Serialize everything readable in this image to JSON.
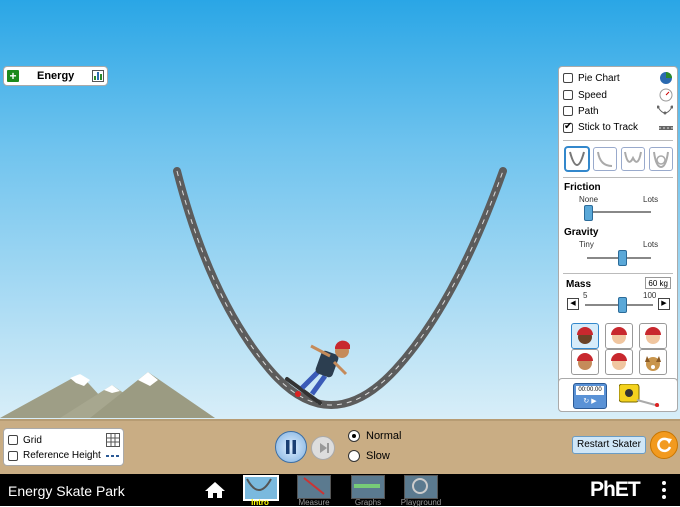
{
  "energy_panel": {
    "label": "Energy"
  },
  "options": [
    {
      "label": "Pie Chart",
      "checked": false,
      "icon": "pie-chart-icon"
    },
    {
      "label": "Speed",
      "checked": false,
      "icon": "speedometer-icon"
    },
    {
      "label": "Path",
      "checked": false,
      "icon": "path-icon"
    },
    {
      "label": "Stick to Track",
      "checked": true,
      "icon": "track-icon"
    }
  ],
  "tracks": [
    {
      "name": "parabola",
      "selected": true
    },
    {
      "name": "ramp",
      "selected": false
    },
    {
      "name": "double-well",
      "selected": false
    },
    {
      "name": "loop",
      "selected": false
    }
  ],
  "friction": {
    "label": "Friction",
    "min_label": "None",
    "max_label": "Lots",
    "value_fraction": 0.0
  },
  "gravity": {
    "label": "Gravity",
    "min_label": "Tiny",
    "max_label": "Lots",
    "value_fraction": 0.5
  },
  "mass": {
    "label": "Mass",
    "value": "60 kg",
    "min_label": "5",
    "max_label": "100",
    "value_fraction": 0.55
  },
  "skaters": [
    "skater-1",
    "skater-2",
    "skater-3",
    "skater-4",
    "skater-5",
    "skater-dog"
  ],
  "tools": {
    "stopwatch_time": "00:00.00"
  },
  "view_options": [
    {
      "label": "Grid",
      "checked": false,
      "icon": "grid-icon"
    },
    {
      "label": "Reference Height",
      "checked": false,
      "icon": "reference-line-icon"
    }
  ],
  "speed_options": [
    {
      "label": "Normal",
      "selected": true
    },
    {
      "label": "Slow",
      "selected": false
    }
  ],
  "restart_label": "Restart Skater",
  "app_title": "Energy Skate Park",
  "screens": [
    {
      "label": "Intro",
      "selected": true
    },
    {
      "label": "Measure",
      "selected": false
    },
    {
      "label": "Graphs",
      "selected": false
    },
    {
      "label": "Playground",
      "selected": false
    }
  ],
  "brand": "PhET",
  "colors": {
    "sky_top": "#2aa6e6",
    "ground": "#c9ad84",
    "accent": "#f29a1f",
    "navbar": "#000000"
  }
}
